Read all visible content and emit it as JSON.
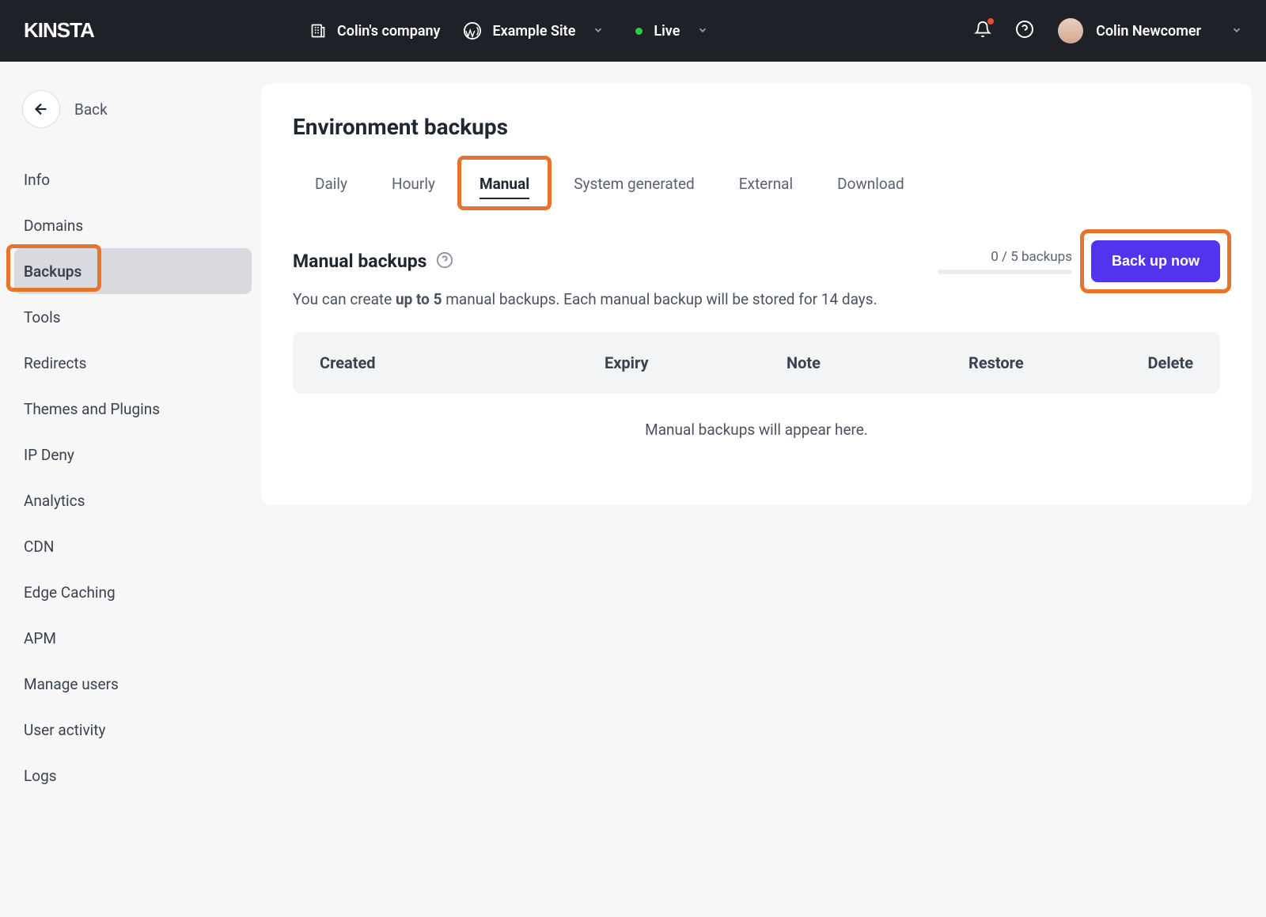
{
  "header": {
    "logo_text": "kinsta",
    "company": "Colin's company",
    "site": "Example Site",
    "env": "Live",
    "user": "Colin Newcomer"
  },
  "sidebar": {
    "back": "Back",
    "items": [
      {
        "label": "Info"
      },
      {
        "label": "Domains"
      },
      {
        "label": "Backups"
      },
      {
        "label": "Tools"
      },
      {
        "label": "Redirects"
      },
      {
        "label": "Themes and Plugins"
      },
      {
        "label": "IP Deny"
      },
      {
        "label": "Analytics"
      },
      {
        "label": "CDN"
      },
      {
        "label": "Edge Caching"
      },
      {
        "label": "APM"
      },
      {
        "label": "Manage users"
      },
      {
        "label": "User activity"
      },
      {
        "label": "Logs"
      }
    ]
  },
  "main": {
    "title": "Environment backups",
    "tabs": [
      {
        "label": "Daily"
      },
      {
        "label": "Hourly"
      },
      {
        "label": "Manual"
      },
      {
        "label": "System generated"
      },
      {
        "label": "External"
      },
      {
        "label": "Download"
      }
    ],
    "section_title": "Manual backups",
    "count_text": "0 / 5 backups",
    "button": "Back up now",
    "desc_pre": "You can create ",
    "desc_bold": "up to 5",
    "desc_post": " manual backups. Each manual backup will be stored for 14 days.",
    "cols": {
      "created": "Created",
      "expiry": "Expiry",
      "note": "Note",
      "restore": "Restore",
      "delete": "Delete"
    },
    "empty": "Manual backups will appear here."
  }
}
